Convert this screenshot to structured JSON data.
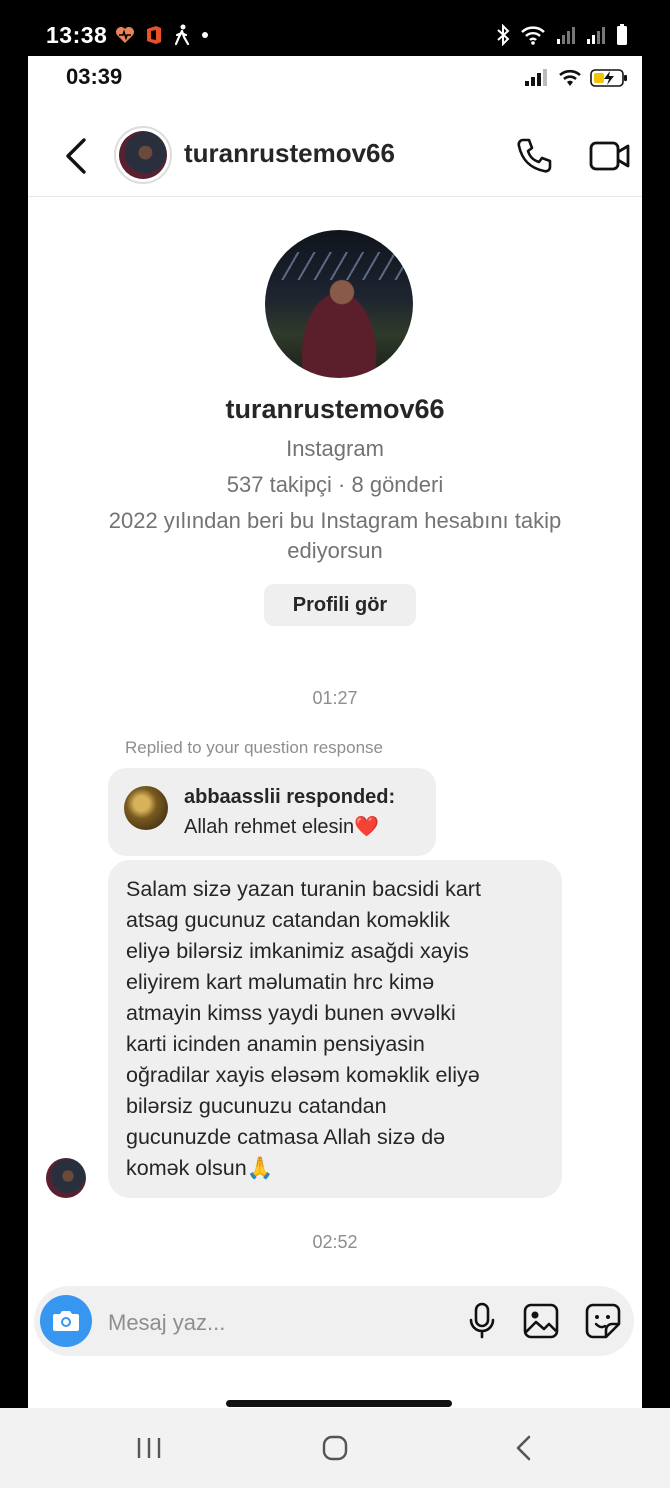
{
  "outer_status": {
    "time": "13:38"
  },
  "ios_status": {
    "time": "03:39"
  },
  "header": {
    "username": "turanrustemov66"
  },
  "profile": {
    "name": "turanrustemov66",
    "platform": "Instagram",
    "stats": "537 takipçi · 8 gönderi",
    "since": "2022 yılından beri bu Instagram hesabını takip ediyorsun",
    "view_profile_label": "Profili gör"
  },
  "thread": {
    "timestamp_1": "01:27",
    "replied_note": "Replied to your question response",
    "reply_card": {
      "title": "abbaasslii responded:",
      "text": "Allah rehmet elesin",
      "emoji": "❤️"
    },
    "message_lines": [
      "Salam sizə yazan turanin bacsidi kart",
      "atsag gucunuz catandan koməklik",
      "eliyə bilərsiz imkanimiz asağdi xayis",
      "eliyirem kart məlumatin hrc kimə",
      "atmayin kimss yaydi bunen əvvəlki",
      "karti icinden anamin pensiyasin",
      "oğradilar xayis eləsəm koməklik eliyə",
      "bilərsiz gucunuzu catandan",
      "gucunuzde catmasa Allah sizə də",
      "komək olsun🙏"
    ],
    "timestamp_2": "02:52"
  },
  "composer": {
    "placeholder": "Mesaj yaz..."
  },
  "icons": {
    "back": "chevron-left-icon",
    "call": "phone-icon",
    "video": "video-camera-icon",
    "camera": "camera-icon",
    "mic": "microphone-icon",
    "gallery": "image-icon",
    "sticker": "sticker-icon"
  },
  "colors": {
    "accent_blue": "#3797f0",
    "bubble_gray": "#efefef",
    "heart_red": "#e0262f"
  }
}
